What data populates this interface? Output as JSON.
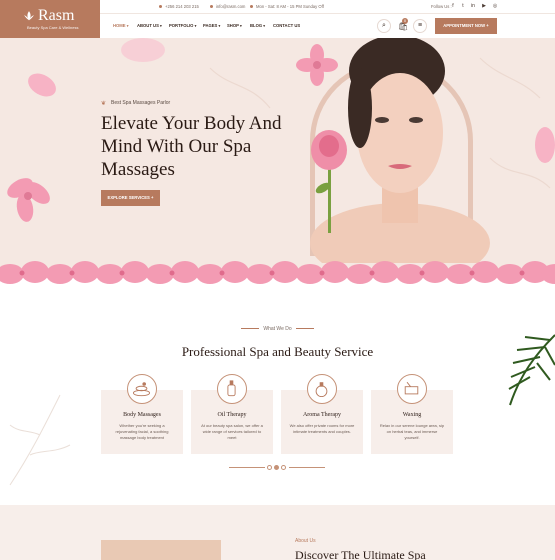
{
  "brand": {
    "name": "Rasm",
    "tagline": "Beauty Spa Care & Wellness"
  },
  "topbar": {
    "phone": "+256 214 203 215",
    "email": "info@rasm.com",
    "hours": "Mon - Sat: 8 AM - 15 PM Sunday Off",
    "follow_label": "Follow Us :",
    "social_icons": [
      "facebook-icon",
      "twitter-icon",
      "linkedin-icon",
      "youtube-icon",
      "instagram-icon"
    ]
  },
  "nav": {
    "items": [
      {
        "label": "HOME",
        "caret": "▾",
        "active": true
      },
      {
        "label": "ABOUT US",
        "caret": "▾"
      },
      {
        "label": "PORTFOLIO",
        "caret": "▾"
      },
      {
        "label": "PAGES",
        "caret": "▾"
      },
      {
        "label": "SHOP",
        "caret": "▾"
      },
      {
        "label": "BLOG",
        "caret": "▾"
      },
      {
        "label": "CONTACT US",
        "caret": ""
      }
    ],
    "cart_count": "0",
    "cta_label": "APPOINTMENT NOW +"
  },
  "hero": {
    "kicker": "Best Spa Massages Parlor",
    "title": "Elevate Your Body And Mind With Our Spa Massages",
    "button_label": "EXPLORE SERVICES +"
  },
  "services": {
    "kicker": "What We Do",
    "title": "Professional Spa and Beauty Service",
    "cards": [
      {
        "title": "Body Massages",
        "desc": "Whether you're seeking a rejuvenating facial, a soothing massage body treatment",
        "icon": "massage-stones-icon"
      },
      {
        "title": "Oil Therapy",
        "desc": "At our beauty spa salon, we offer a wide range of services tailored to meet",
        "icon": "oil-bottle-icon"
      },
      {
        "title": "Aroma Therapy",
        "desc": "We also offer private rooms for more intimate treatments and couples.",
        "icon": "aroma-oil-icon"
      },
      {
        "title": "Waxing",
        "desc": "Relax in our serene lounge area, sip on herbal teas, and immerse yourself.",
        "icon": "wax-icon"
      }
    ],
    "page_count": 3,
    "active_page": 2
  },
  "about": {
    "kicker": "About Us",
    "title": "Discover The Ultimate Spa"
  },
  "colors": {
    "accent": "#b77a5e",
    "hero_bg": "#f5e8e2",
    "card_bg": "#f7eeea",
    "petal": "#f39bb3"
  }
}
